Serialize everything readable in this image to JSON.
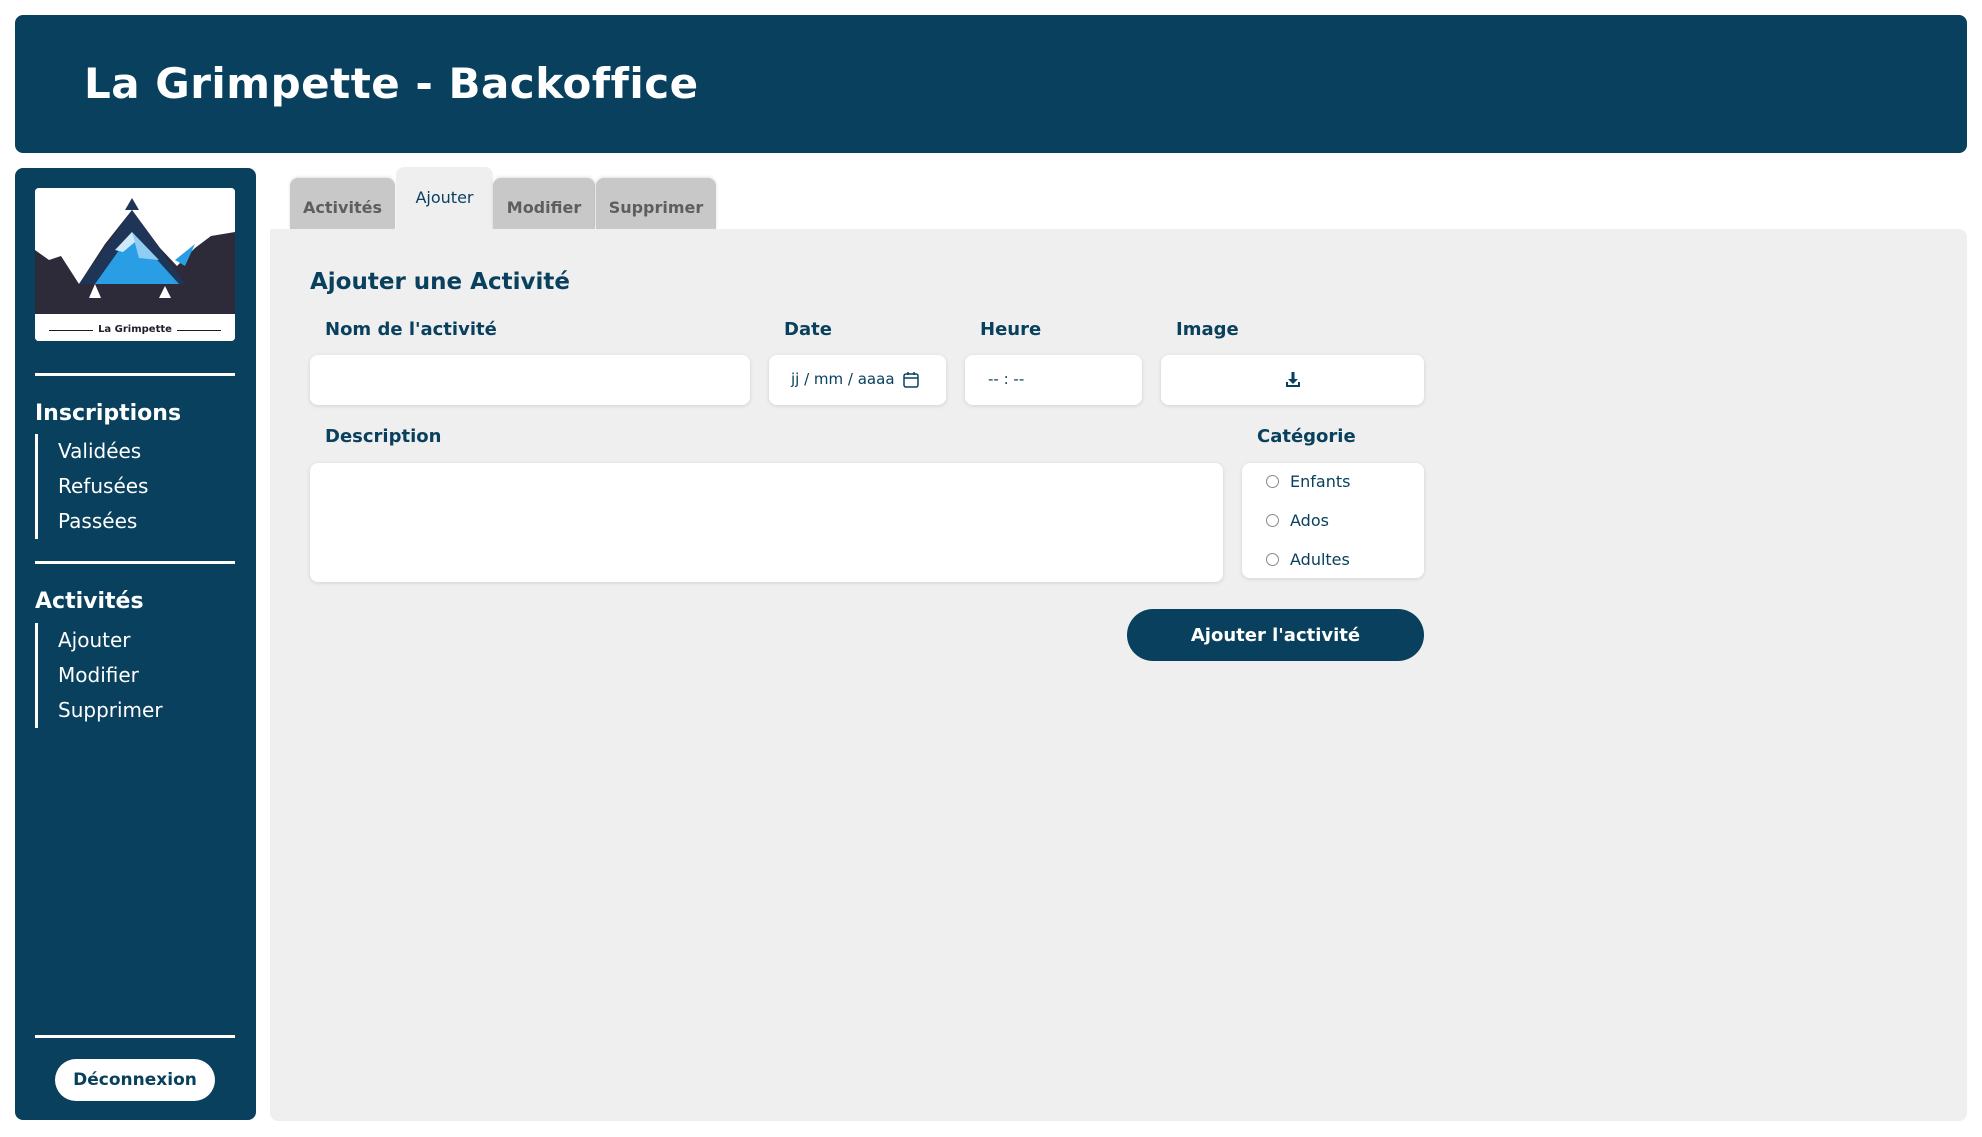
{
  "header": {
    "title": "La Grimpette - Backoffice"
  },
  "sidebar": {
    "logo_caption": "La Grimpette",
    "sections": [
      {
        "title": "Inscriptions",
        "items": [
          "Validées",
          "Refusées",
          "Passées"
        ]
      },
      {
        "title": "Activités",
        "items": [
          "Ajouter",
          "Modifier",
          "Supprimer"
        ]
      }
    ],
    "logout_label": "Déconnexion"
  },
  "tabs": [
    {
      "label": "Activités",
      "active": false
    },
    {
      "label": "Ajouter",
      "active": true
    },
    {
      "label": "Modifier",
      "active": false
    },
    {
      "label": "Supprimer",
      "active": false
    }
  ],
  "form": {
    "title": "Ajouter une Activité",
    "name_label": "Nom de l'activité",
    "name_value": "",
    "date_label": "Date",
    "date_placeholder": "jj / mm / aaaa",
    "time_label": "Heure",
    "time_placeholder": "-- : --",
    "image_label": "Image",
    "description_label": "Description",
    "description_value": "",
    "category_label": "Catégorie",
    "categories": [
      "Enfants",
      "Ados",
      "Adultes"
    ],
    "submit_label": "Ajouter l'activité"
  },
  "colors": {
    "primary": "#09405d",
    "panel_bg": "#efefef",
    "tab_inactive": "#c8c8c8",
    "logo_blue": "#2a9ee4"
  },
  "icons": [
    "calendar-icon",
    "download-icon",
    "mountain-logo"
  ]
}
